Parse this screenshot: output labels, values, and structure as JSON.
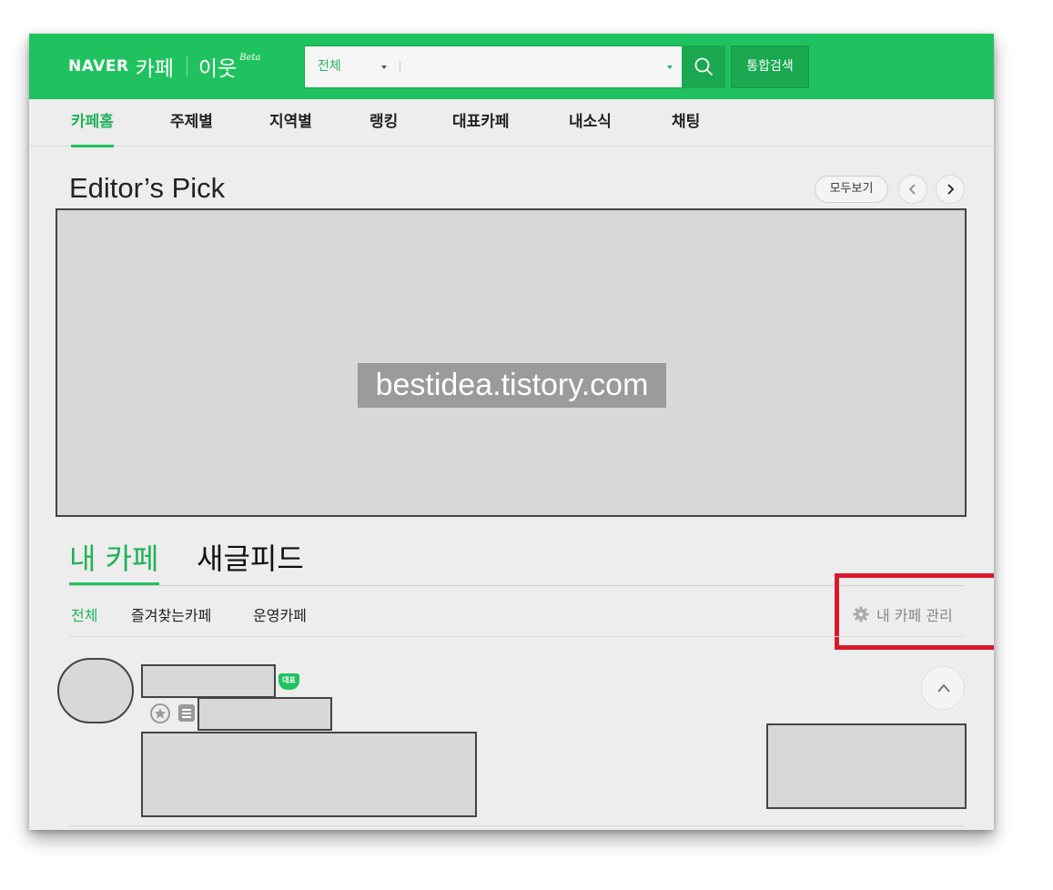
{
  "header": {
    "logo_naver": "NAVER",
    "logo_cafe": "카페",
    "logo_neighbor": "이웃",
    "logo_beta": "Beta",
    "search_scope": "전체",
    "search_value": "",
    "total_search_label": "통합검색"
  },
  "nav": {
    "tabs": [
      "카페홈",
      "주제별",
      "지역별",
      "랭킹",
      "대표카페",
      "내소식",
      "채팅"
    ],
    "active_tab": "카페홈"
  },
  "editors_pick": {
    "title": "Editor’s Pick",
    "more_label": "모두보기",
    "watermark": "bestidea.tistory.com"
  },
  "my_cafe": {
    "tabs": [
      "내 카페",
      "새글피드"
    ],
    "active_tab": "내 카페",
    "filters": [
      "전체",
      "즐겨찾는카페",
      "운영카페"
    ],
    "active_filter": "전체",
    "manage_label": "내 카페 관리",
    "item": {
      "badge": "대표"
    }
  },
  "colors": {
    "brand_green": "#20c25f",
    "highlight_red": "#d8192d"
  }
}
